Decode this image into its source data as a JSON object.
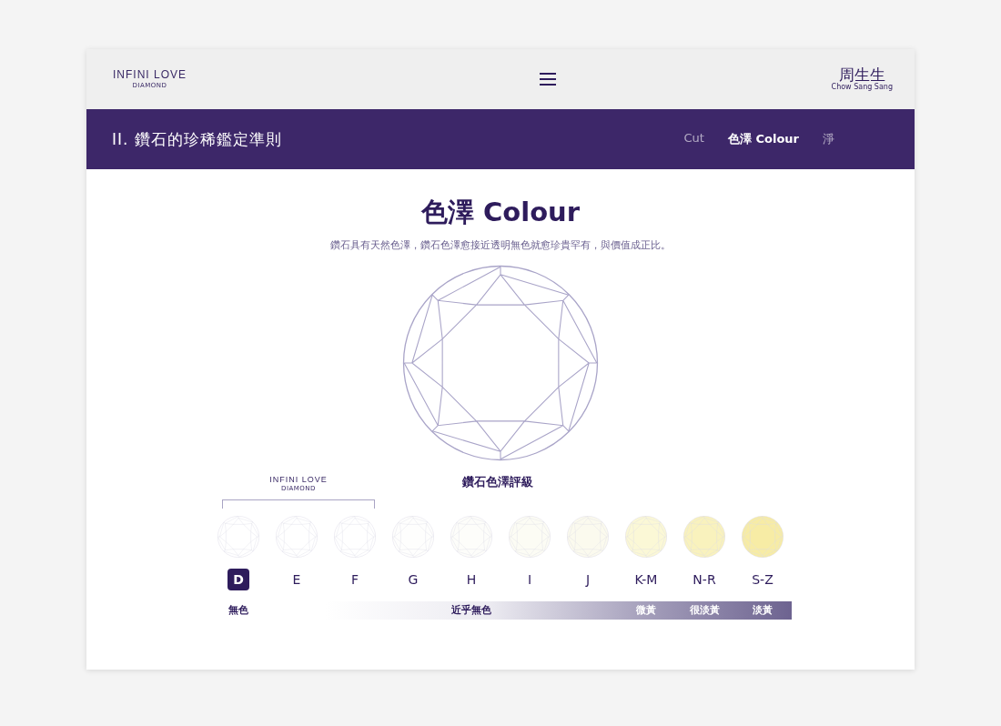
{
  "header": {
    "brand": {
      "name": "INFINI LOVE",
      "sub": "DIAMOND"
    },
    "partner": {
      "name": "周生生",
      "sub": "Chow Sang Sang"
    }
  },
  "section_bar": {
    "numeral": "II.",
    "title": "鑽石的珍稀鑑定準則",
    "tabs": [
      {
        "label": "Cut",
        "selected": false
      },
      {
        "label": "色澤 Colour",
        "selected": true
      },
      {
        "label": "淨",
        "selected": false
      }
    ]
  },
  "heading": "色澤 Colour",
  "intro": "鑽石具有天然色澤，鑽石色澤愈接近透明無色就愈珍貴罕有，與價值成正比。",
  "scale": {
    "brand": {
      "name": "INFINI LOVE",
      "sub": "DIAMOND"
    },
    "title": "鑽石色澤評級",
    "grades": [
      {
        "label": "D",
        "selected": true,
        "color": "#ffffff"
      },
      {
        "label": "E",
        "selected": false,
        "color": "#ffffff"
      },
      {
        "label": "F",
        "selected": false,
        "color": "#ffffff"
      },
      {
        "label": "G",
        "selected": false,
        "color": "#fefefd"
      },
      {
        "label": "H",
        "selected": false,
        "color": "#fdfdfa"
      },
      {
        "label": "I",
        "selected": false,
        "color": "#fcfcf4"
      },
      {
        "label": "J",
        "selected": false,
        "color": "#fbfaee"
      },
      {
        "label": "K-M",
        "selected": false,
        "color": "#fbf8d6"
      },
      {
        "label": "N-R",
        "selected": false,
        "color": "#f9f2bd"
      },
      {
        "label": "S-Z",
        "selected": false,
        "color": "#f7eca5"
      }
    ],
    "bands": [
      {
        "label": "無色"
      },
      {
        "label": "近乎無色"
      },
      {
        "label": "微黃"
      },
      {
        "label": "很淡黃"
      },
      {
        "label": "淡黃"
      }
    ]
  }
}
